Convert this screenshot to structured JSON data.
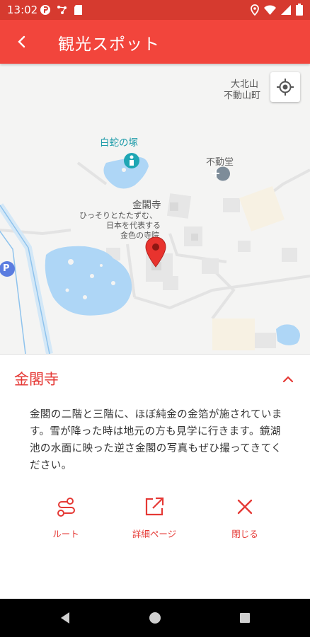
{
  "status_bar": {
    "time": "13:02",
    "left_icons": [
      "cloud-app-icon",
      "network-dots-icon",
      "sd-card-icon"
    ],
    "right_icons": [
      "location-icon",
      "wifi-icon",
      "signal-icon",
      "battery-icon"
    ]
  },
  "app_bar": {
    "back_icon": "chevron-left-icon",
    "title": "観光スポット"
  },
  "map": {
    "labels": {
      "area_line1": "大北山",
      "area_line2": "不動山町",
      "hakuja": "白蛇の塚",
      "fudodo": "不動堂",
      "kinkakuji": "金閣寺",
      "kinkakuji_desc1": "ひっそりとたたずむ、",
      "kinkakuji_desc2": "日本を代表する",
      "kinkakuji_desc3": "金色の寺院",
      "parking": "P"
    },
    "locate_icon": "my-location-icon",
    "marker_icon": "map-pin-icon",
    "colors": {
      "water": "#aed6f6",
      "marker": "#e8332e",
      "poi_teal": "#1ea6b4",
      "poi_gray": "#7d8c99",
      "parking": "#5b7de0"
    }
  },
  "detail": {
    "title": "金閣寺",
    "collapse_icon": "chevron-up-icon",
    "description": "金閣の二階と三階に、ほぼ純金の金箔が施されています。雪が降った時は地元の方も見学に行きます。鏡湖池の水面に映った逆さ金閣の写真もぜひ撮ってきてください。",
    "actions": [
      {
        "label": "ルート",
        "icon": "route-icon"
      },
      {
        "label": "詳細ページ",
        "icon": "open-external-icon"
      },
      {
        "label": "閉じる",
        "icon": "close-icon"
      }
    ],
    "accent_color": "#e53935"
  },
  "nav_bar": {
    "buttons": [
      "back-triangle-icon",
      "home-circle-icon",
      "recents-square-icon"
    ]
  }
}
